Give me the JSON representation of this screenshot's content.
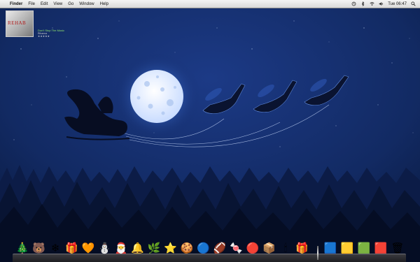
{
  "menubar": {
    "apple_glyph": "",
    "app_name": "Finder",
    "menus": [
      "File",
      "Edit",
      "View",
      "Go",
      "Window",
      "Help"
    ],
    "clock": "Tue 06:47"
  },
  "now_playing": {
    "album_text": "REHAB",
    "track": "Don't Stop The Music",
    "artist": "Rihanna",
    "rating": "★★★★★"
  },
  "dock": {
    "apps": [
      {
        "name": "christmas-tree",
        "glyph": "🎄"
      },
      {
        "name": "polar-bear",
        "glyph": "🐻"
      },
      {
        "name": "snowflake",
        "glyph": "❄"
      },
      {
        "name": "gift-box",
        "glyph": "🎁"
      },
      {
        "name": "orange-ornament",
        "glyph": "🧡"
      },
      {
        "name": "snowman",
        "glyph": "⛄"
      },
      {
        "name": "santa",
        "glyph": "🎅"
      },
      {
        "name": "bells",
        "glyph": "🔔"
      },
      {
        "name": "wreath",
        "glyph": "🌿"
      },
      {
        "name": "star",
        "glyph": "⭐"
      },
      {
        "name": "gingerbread-man",
        "glyph": "🍪"
      },
      {
        "name": "blue-ornament",
        "glyph": "🔵"
      },
      {
        "name": "football",
        "glyph": "🏈"
      },
      {
        "name": "candy-cane",
        "glyph": "🍬"
      },
      {
        "name": "red-ornament",
        "glyph": "🔴"
      },
      {
        "name": "present-box",
        "glyph": "📦"
      },
      {
        "name": "candle",
        "glyph": "🕯"
      },
      {
        "name": "wrapped-gift",
        "glyph": "🎁"
      }
    ],
    "folders": [
      {
        "name": "blue-box",
        "glyph": "🟦"
      },
      {
        "name": "yellow-box",
        "glyph": "🟨"
      },
      {
        "name": "green-box",
        "glyph": "🟩"
      },
      {
        "name": "red-box",
        "glyph": "🟥"
      },
      {
        "name": "trash",
        "glyph": "🗑"
      }
    ]
  }
}
